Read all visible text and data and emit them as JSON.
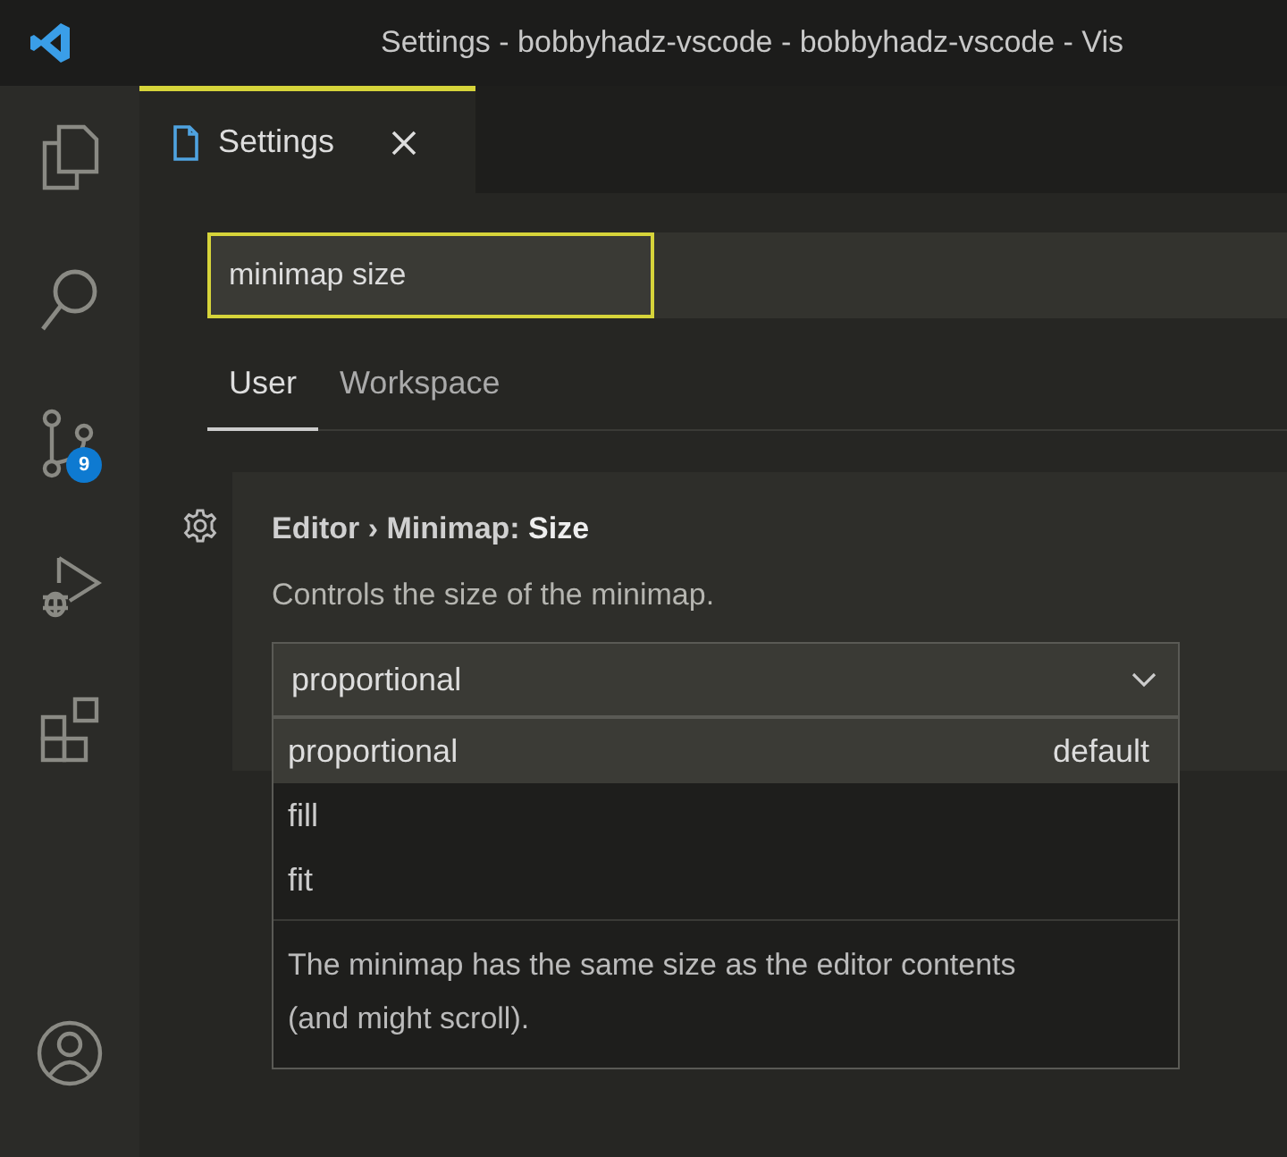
{
  "window": {
    "title": "Settings - bobbyhadz-vscode - bobbyhadz-vscode - Vis"
  },
  "activity_bar": {
    "items": [
      {
        "kind": "explorer"
      },
      {
        "kind": "search"
      },
      {
        "kind": "source-control",
        "badge": "9"
      },
      {
        "kind": "run-debug"
      },
      {
        "kind": "extensions"
      }
    ],
    "account": {
      "kind": "account"
    }
  },
  "editor_tabs": [
    {
      "label": "Settings",
      "selected": true
    }
  ],
  "search": {
    "value": "minimap size"
  },
  "scope_tabs": [
    {
      "label": "User",
      "selected": true
    },
    {
      "label": "Workspace",
      "selected": false
    }
  ],
  "setting": {
    "title": "Editor › Minimap: **Size**",
    "description": "Controls the size of the minimap.",
    "value": "proportional",
    "options": [
      {
        "label": "proportional",
        "note": "default",
        "selected": true
      },
      {
        "label": "fill",
        "selected": false
      },
      {
        "label": "fit",
        "selected": false
      }
    ],
    "option_description": "The minimap has the same size as the editor contents (and might scroll)."
  }
}
